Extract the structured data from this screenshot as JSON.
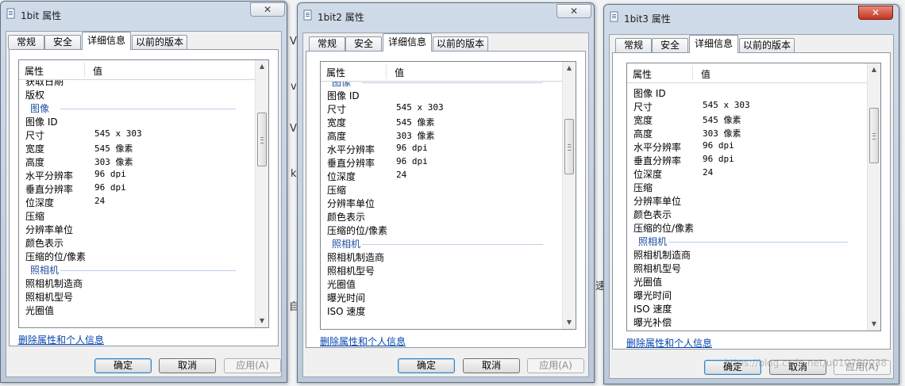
{
  "header": {
    "col_property": "属性",
    "col_value": "值"
  },
  "tabs": [
    "常规",
    "安全",
    "详细信息",
    "以前的版本"
  ],
  "active_tab": 2,
  "link_text": "删除属性和个人信息",
  "buttons": {
    "ok": "确定",
    "cancel": "取消",
    "apply": "应用(A)"
  },
  "close_glyph": "✕",
  "background_chars": [
    "V",
    "v",
    "V",
    "k",
    "自",
    "速"
  ],
  "watermark": "https://blog.csdn.net/u010789038",
  "windows": [
    {
      "title": "1bit 属性",
      "close_style": "normal",
      "rows": [
        {
          "kind": "prop",
          "prop": "获取日期",
          "value": ""
        },
        {
          "kind": "prop",
          "prop": "版权",
          "value": ""
        },
        {
          "kind": "section",
          "label": "图像"
        },
        {
          "kind": "prop",
          "prop": "图像 ID",
          "value": ""
        },
        {
          "kind": "prop",
          "prop": "尺寸",
          "value": "545 x 303"
        },
        {
          "kind": "prop",
          "prop": "宽度",
          "value": "545 像素"
        },
        {
          "kind": "prop",
          "prop": "高度",
          "value": "303 像素"
        },
        {
          "kind": "prop",
          "prop": "水平分辨率",
          "value": "96 dpi"
        },
        {
          "kind": "prop",
          "prop": "垂直分辨率",
          "value": "96 dpi"
        },
        {
          "kind": "prop",
          "prop": "位深度",
          "value": "24"
        },
        {
          "kind": "prop",
          "prop": "压缩",
          "value": ""
        },
        {
          "kind": "prop",
          "prop": "分辨率单位",
          "value": ""
        },
        {
          "kind": "prop",
          "prop": "颜色表示",
          "value": ""
        },
        {
          "kind": "prop",
          "prop": "压缩的位/像素",
          "value": ""
        },
        {
          "kind": "section",
          "label": "照相机"
        },
        {
          "kind": "prop",
          "prop": "照相机制造商",
          "value": ""
        },
        {
          "kind": "prop",
          "prop": "照相机型号",
          "value": ""
        },
        {
          "kind": "prop",
          "prop": "光圈值",
          "value": ""
        }
      ]
    },
    {
      "title": "1bit2 属性",
      "close_style": "normal",
      "rows": [
        {
          "kind": "section",
          "label": "图像"
        },
        {
          "kind": "prop",
          "prop": "图像 ID",
          "value": ""
        },
        {
          "kind": "prop",
          "prop": "尺寸",
          "value": "545 x 303"
        },
        {
          "kind": "prop",
          "prop": "宽度",
          "value": "545 像素"
        },
        {
          "kind": "prop",
          "prop": "高度",
          "value": "303 像素"
        },
        {
          "kind": "prop",
          "prop": "水平分辨率",
          "value": "96 dpi"
        },
        {
          "kind": "prop",
          "prop": "垂直分辨率",
          "value": "96 dpi"
        },
        {
          "kind": "prop",
          "prop": "位深度",
          "value": "24"
        },
        {
          "kind": "prop",
          "prop": "压缩",
          "value": ""
        },
        {
          "kind": "prop",
          "prop": "分辨率单位",
          "value": ""
        },
        {
          "kind": "prop",
          "prop": "颜色表示",
          "value": ""
        },
        {
          "kind": "prop",
          "prop": "压缩的位/像素",
          "value": ""
        },
        {
          "kind": "section",
          "label": "照相机"
        },
        {
          "kind": "prop",
          "prop": "照相机制造商",
          "value": ""
        },
        {
          "kind": "prop",
          "prop": "照相机型号",
          "value": ""
        },
        {
          "kind": "prop",
          "prop": "光圈值",
          "value": ""
        },
        {
          "kind": "prop",
          "prop": "曝光时间",
          "value": ""
        },
        {
          "kind": "prop",
          "prop": "ISO 速度",
          "value": ""
        }
      ]
    },
    {
      "title": "1bit3 属性",
      "close_style": "red",
      "rows": [
        {
          "kind": "prop",
          "prop": "图像 ID",
          "value": ""
        },
        {
          "kind": "prop",
          "prop": "尺寸",
          "value": "545 x 303"
        },
        {
          "kind": "prop",
          "prop": "宽度",
          "value": "545 像素"
        },
        {
          "kind": "prop",
          "prop": "高度",
          "value": "303 像素"
        },
        {
          "kind": "prop",
          "prop": "水平分辨率",
          "value": "96 dpi"
        },
        {
          "kind": "prop",
          "prop": "垂直分辨率",
          "value": "96 dpi"
        },
        {
          "kind": "prop",
          "prop": "位深度",
          "value": "24"
        },
        {
          "kind": "prop",
          "prop": "压缩",
          "value": ""
        },
        {
          "kind": "prop",
          "prop": "分辨率单位",
          "value": ""
        },
        {
          "kind": "prop",
          "prop": "颜色表示",
          "value": ""
        },
        {
          "kind": "prop",
          "prop": "压缩的位/像素",
          "value": ""
        },
        {
          "kind": "section",
          "label": "照相机"
        },
        {
          "kind": "prop",
          "prop": "照相机制造商",
          "value": ""
        },
        {
          "kind": "prop",
          "prop": "照相机型号",
          "value": ""
        },
        {
          "kind": "prop",
          "prop": "光圈值",
          "value": ""
        },
        {
          "kind": "prop",
          "prop": "曝光时间",
          "value": ""
        },
        {
          "kind": "prop",
          "prop": "ISO 速度",
          "value": ""
        },
        {
          "kind": "prop",
          "prop": "曝光补偿",
          "value": ""
        }
      ]
    }
  ]
}
